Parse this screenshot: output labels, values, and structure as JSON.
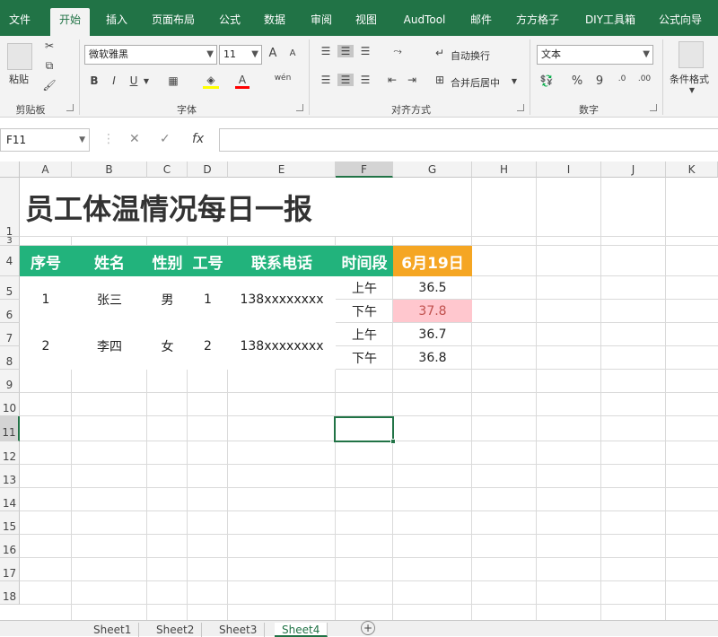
{
  "tabs": [
    "文件",
    "开始",
    "插入",
    "页面布局",
    "公式",
    "数据",
    "审阅",
    "视图",
    "AudTool",
    "邮件",
    "方方格子",
    "DIY工具箱",
    "公式向导"
  ],
  "ribbon": {
    "clipboard": {
      "paste": "粘贴",
      "label": "剪贴板"
    },
    "font": {
      "name": "微软雅黑",
      "size": "11",
      "grow": "A",
      "shrink": "A",
      "bold": "B",
      "italic": "I",
      "underline": "U",
      "fontcolor": "A",
      "wen": "wén",
      "label": "字体"
    },
    "align": {
      "wrap": "自动换行",
      "merge": "合并后居中",
      "label": "对齐方式"
    },
    "number": {
      "format": "文本",
      "percent": "%",
      "comma": "9",
      "label": "数字"
    },
    "styles": {
      "cond": "条件格式"
    }
  },
  "formula": {
    "namebox": "F11",
    "fx": "fx",
    "cancel": "✕",
    "enter": "✓"
  },
  "columns": [
    "A",
    "B",
    "C",
    "D",
    "E",
    "F",
    "G",
    "H",
    "I",
    "J",
    "K"
  ],
  "rows": [
    "1",
    "3",
    "4",
    "5",
    "6",
    "7",
    "8",
    "9",
    "10",
    "11",
    "12",
    "13",
    "14",
    "15",
    "16",
    "17",
    "18"
  ],
  "sheet": {
    "title": "员工体温情况每日一报",
    "headers": [
      "序号",
      "姓名",
      "性别",
      "工号",
      "联系电话",
      "时间段",
      "6月19日"
    ],
    "r1": {
      "no": "1",
      "name": "张三",
      "gender": "男",
      "id": "1",
      "phone": "138xxxxxxxx",
      "t1": "上午",
      "v1": "36.5",
      "t2": "下午",
      "v2": "37.8"
    },
    "r2": {
      "no": "2",
      "name": "李四",
      "gender": "女",
      "id": "2",
      "phone": "138xxxxxxxx",
      "t1": "上午",
      "v1": "36.7",
      "t2": "下午",
      "v2": "36.8"
    }
  },
  "sheets": [
    "Sheet1",
    "Sheet2",
    "Sheet3",
    "Sheet4"
  ],
  "colors": {
    "accent": "#217346",
    "header": "#22b37c",
    "date": "#f5a623",
    "alert_bg": "#ffc7ce",
    "alert_fg": "#c0504d"
  }
}
